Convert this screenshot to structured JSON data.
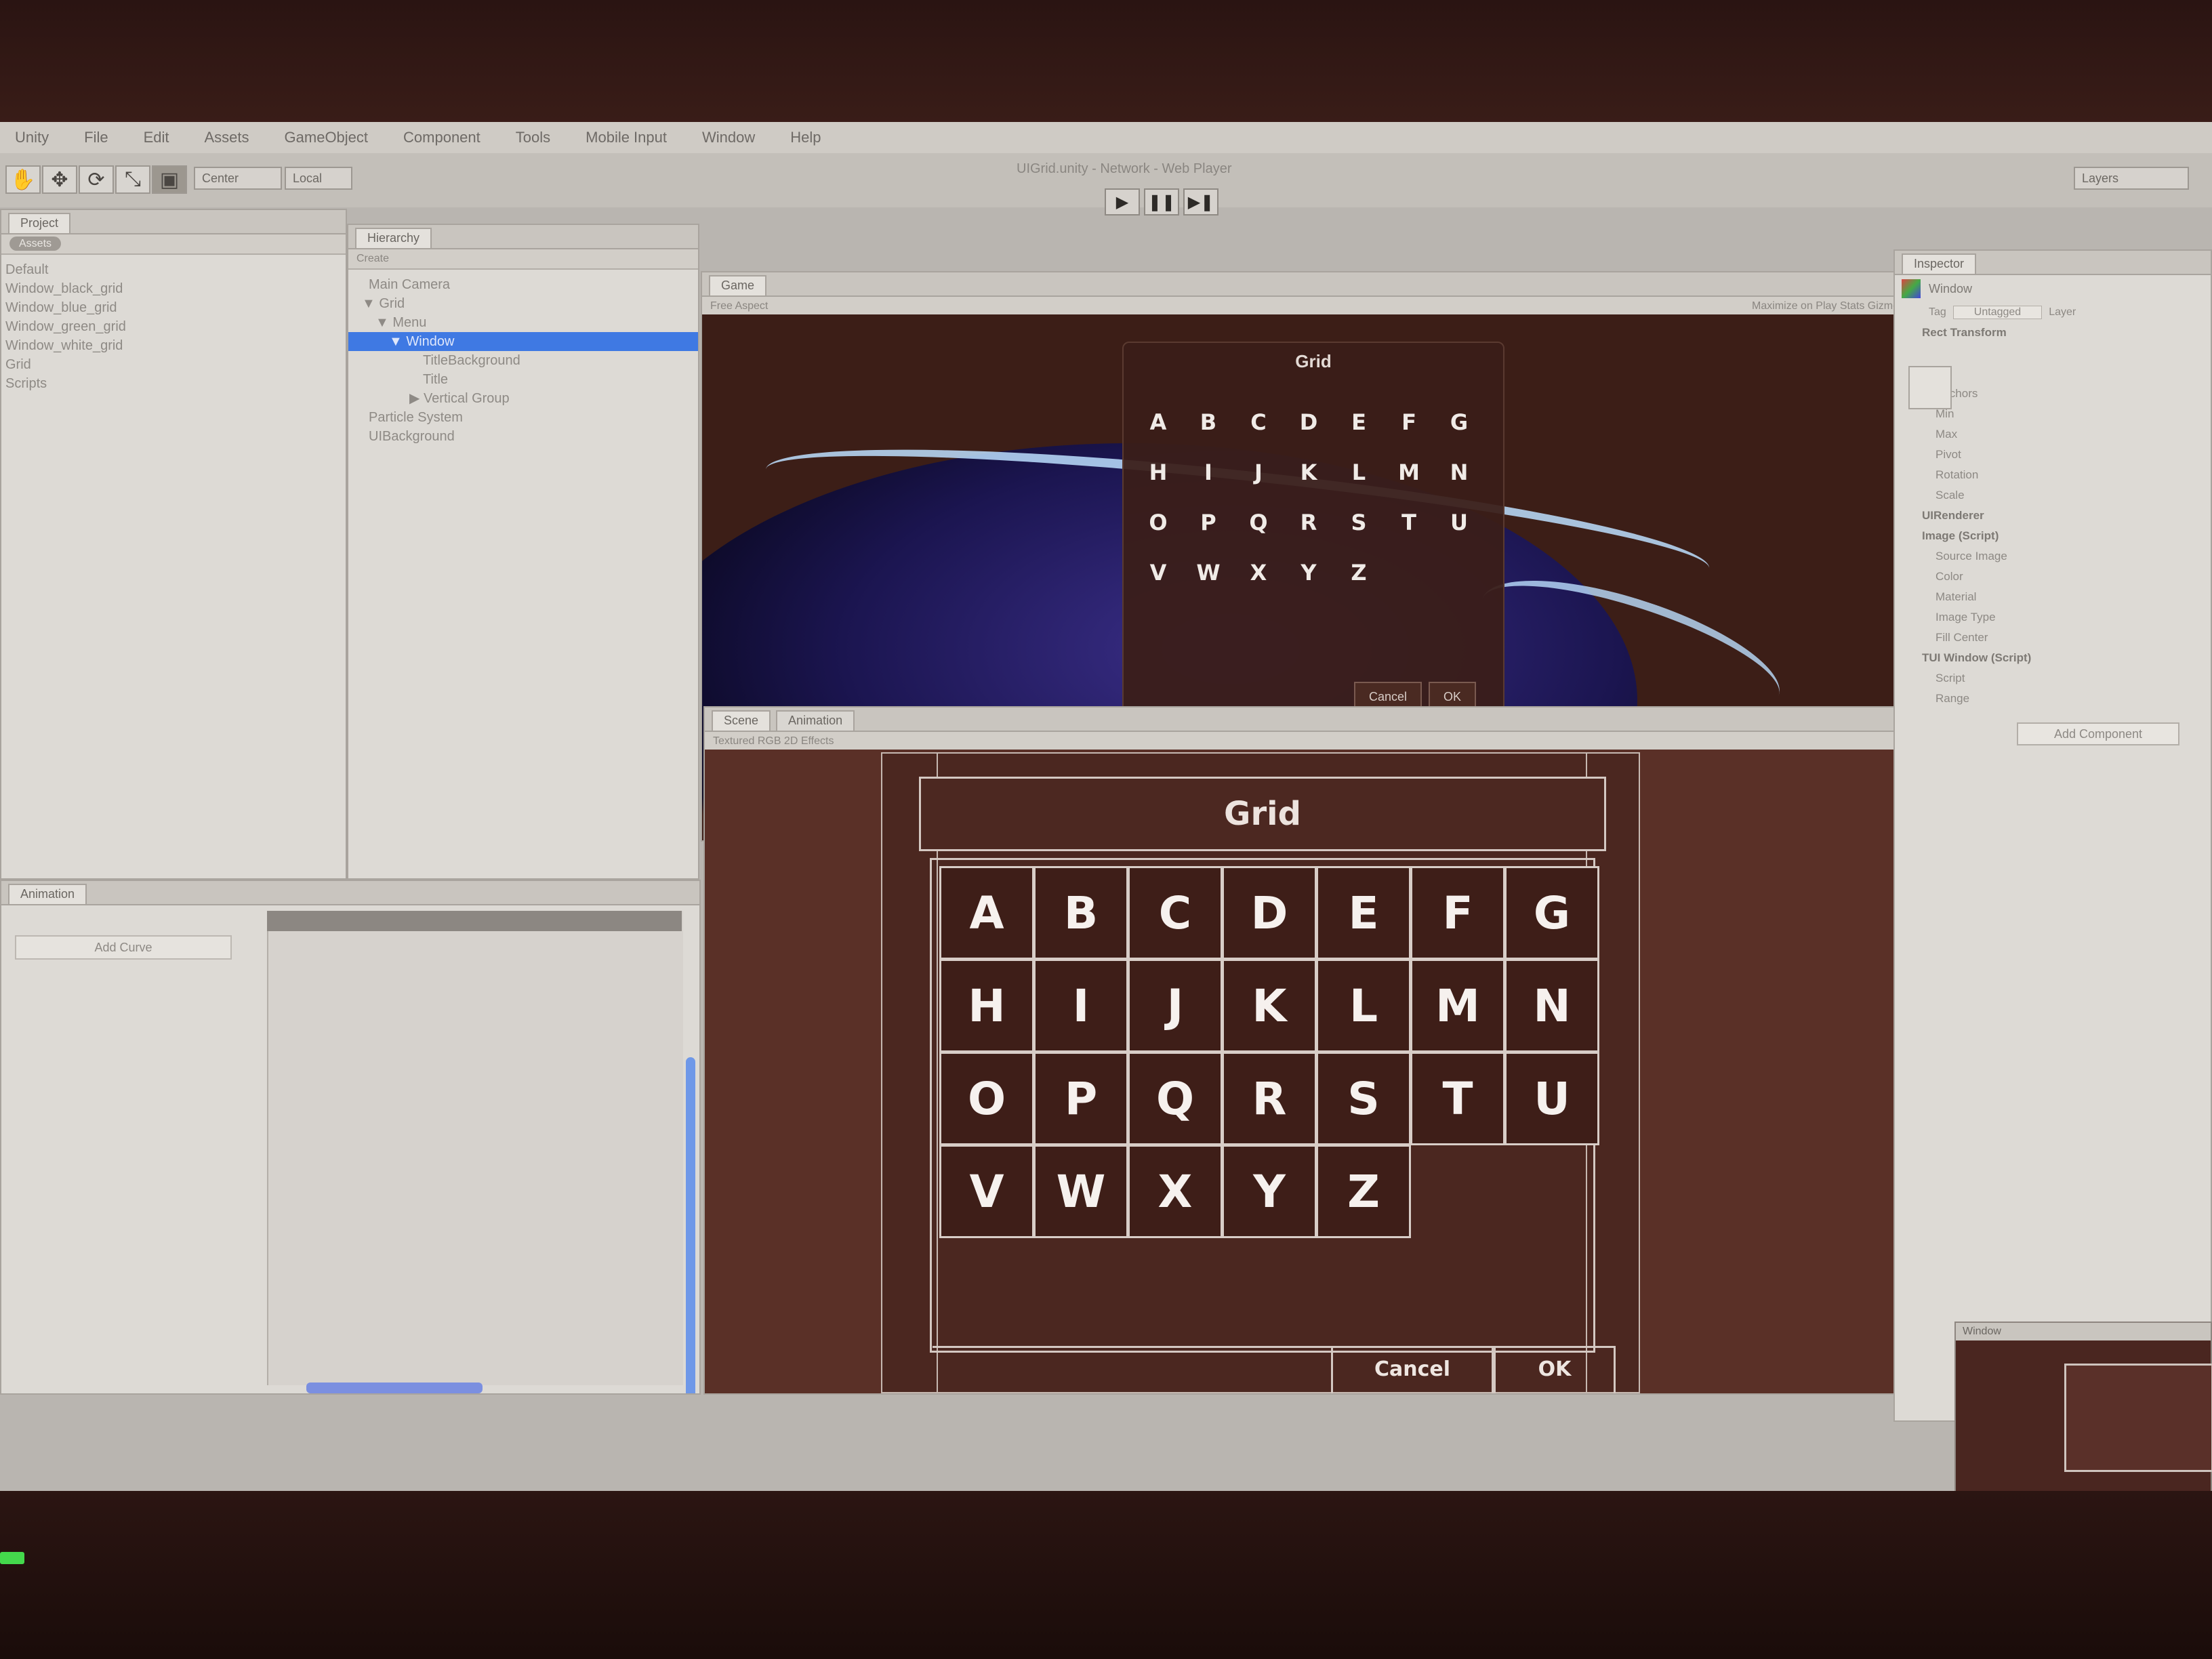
{
  "menu": [
    "Unity",
    "File",
    "Edit",
    "Assets",
    "GameObject",
    "Component",
    "Tools",
    "Mobile Input",
    "Window",
    "Help"
  ],
  "window_title": "UIGrid.unity - Network - Web Player",
  "toolbar": {
    "pivot_label": "Center",
    "local_label": "Local",
    "layers_label": "Layers"
  },
  "project": {
    "tab": "Project",
    "search_tag": "Assets",
    "items": [
      "Default",
      "Window_black_grid",
      "Window_blue_grid",
      "Window_green_grid",
      "Window_white_grid",
      "Grid",
      "Scripts"
    ]
  },
  "hierarchy": {
    "tab": "Hierarchy",
    "subbar": "Create",
    "items": [
      {
        "label": "Main Camera",
        "indent": 0,
        "selected": false
      },
      {
        "label": "Grid",
        "indent": 0,
        "selected": false
      },
      {
        "label": "Menu",
        "indent": 1,
        "selected": false
      },
      {
        "label": "Window",
        "indent": 2,
        "selected": true
      },
      {
        "label": "TitleBackground",
        "indent": 3,
        "selected": false
      },
      {
        "label": "Title",
        "indent": 3,
        "selected": false
      },
      {
        "label": "Vertical Group",
        "indent": 3,
        "selected": false
      },
      {
        "label": "Particle System",
        "indent": 0,
        "selected": false
      },
      {
        "label": "UIBackground",
        "indent": 0,
        "selected": false
      }
    ]
  },
  "animation": {
    "tab": "Animation",
    "add_curve": "Add Curve"
  },
  "game_view": {
    "tab": "Game",
    "subbar": "Free Aspect",
    "subbar_right": "Maximize on Play   Stats   Gizmos",
    "title": "Grid",
    "cancel_label": "Cancel",
    "ok_label": "OK"
  },
  "scene_view": {
    "tab": "Scene",
    "tab2": "Animation",
    "subbar": "Textured   RGB   2D   Effects",
    "title": "Grid",
    "cancel_label": "Cancel",
    "ok_label": "OK"
  },
  "keys": [
    "A",
    "B",
    "C",
    "D",
    "E",
    "F",
    "G",
    "H",
    "I",
    "J",
    "K",
    "L",
    "M",
    "N",
    "O",
    "P",
    "Q",
    "R",
    "S",
    "T",
    "U",
    "V",
    "W",
    "X",
    "Y",
    "Z"
  ],
  "inspector": {
    "tab": "Inspector",
    "object_name": "Window",
    "tag_label": "Tag",
    "tag_value": "Untagged",
    "layer_label": "Layer",
    "rows": [
      "Rect Transform",
      "Anchors",
      "Min",
      "Max",
      "Pivot",
      "Rotation",
      "Scale",
      "UIRenderer",
      "Image (Script)",
      "Source Image",
      "Color",
      "Material",
      "Image Type",
      "Fill Center",
      "TUI Window (Script)",
      "Script",
      "Range"
    ],
    "add_component": "Add Component",
    "preview_tab": "Window"
  },
  "colors": {
    "selection": "#3f79e3",
    "window_brown": "#4b2720",
    "key_text": "#f6f1ee"
  }
}
